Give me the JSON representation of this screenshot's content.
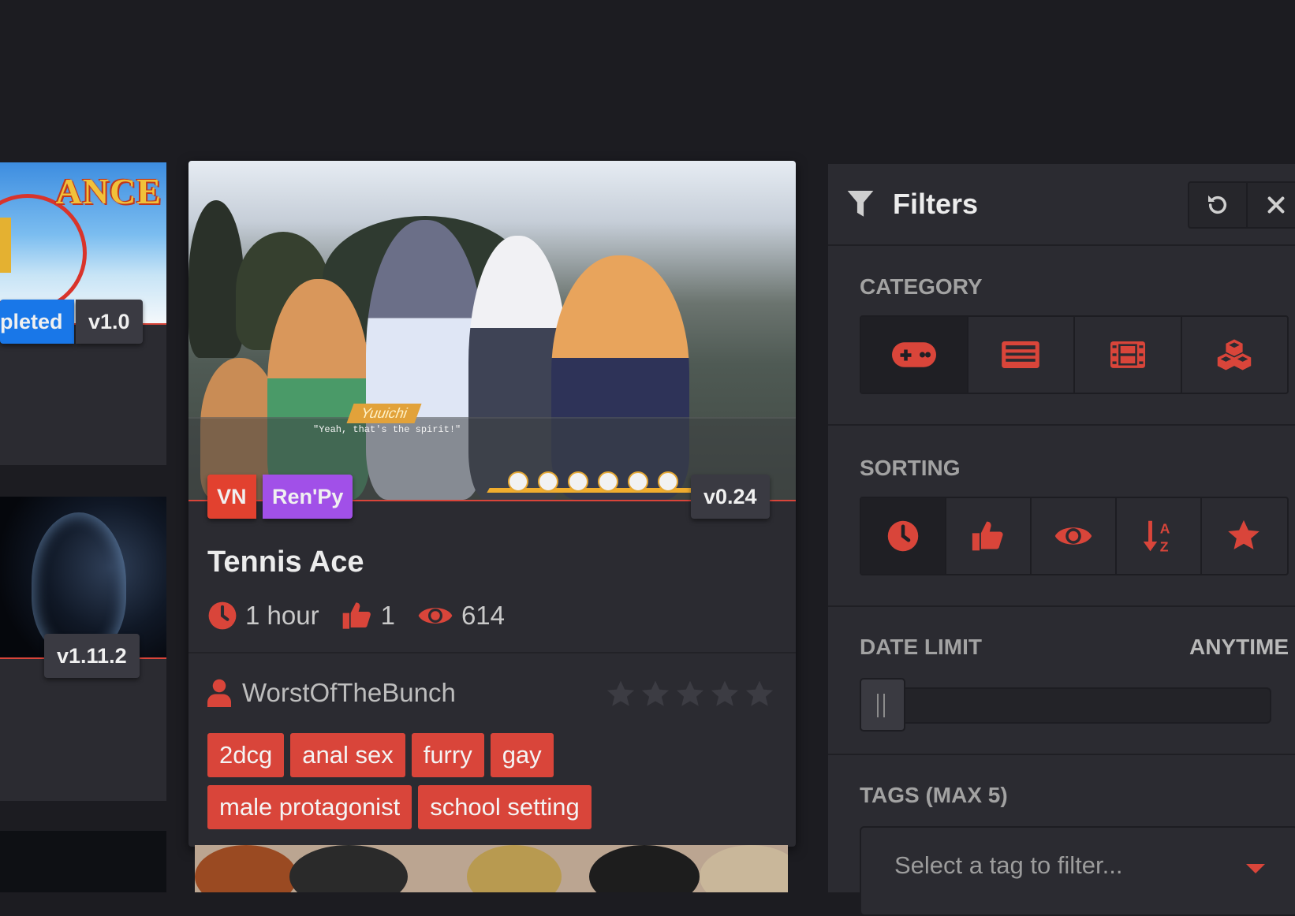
{
  "left_cards": [
    {
      "status": "pleted",
      "version": "v1.0",
      "logo_text": "ANCE"
    },
    {
      "version": "v1.11.2"
    }
  ],
  "card": {
    "category": "VN",
    "engine": "Ren'Py",
    "version": "v0.24",
    "title": "Tennis Ace",
    "updated": "1 hour",
    "likes": "1",
    "views": "614",
    "author": "WorstOfTheBunch",
    "tags": [
      "2dcg",
      "anal sex",
      "furry",
      "gay",
      "male protagonist",
      "school setting"
    ],
    "cover": {
      "speaker": "Yuuichi",
      "line": "\"Yeah, that's the spirit!\""
    }
  },
  "filters": {
    "title": "Filters",
    "category_label": "CATEGORY",
    "sorting_label": "SORTING",
    "date_label": "DATE LIMIT",
    "date_value": "ANYTIME",
    "tags_label": "TAGS (MAX 5)",
    "tag_placeholder": "Select a tag to filter..."
  },
  "colors": {
    "accent": "#d9453a",
    "background": "#1c1c21",
    "panel": "#2b2b31",
    "completed_badge": "#1977e8",
    "engine_badge": "#a150e8"
  }
}
